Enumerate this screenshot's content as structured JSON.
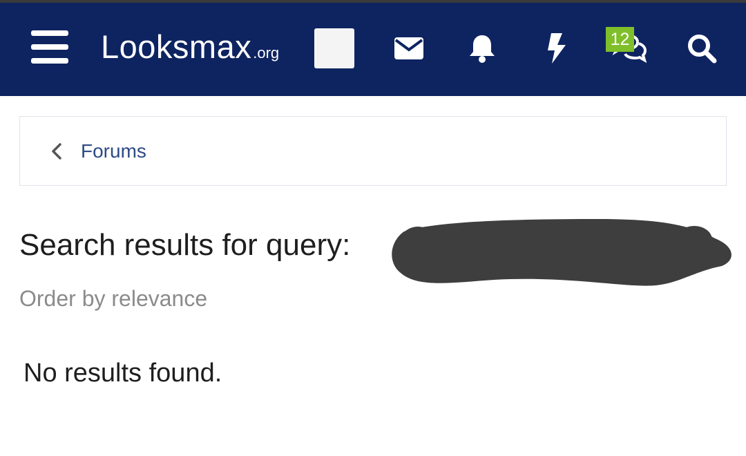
{
  "header": {
    "logo_main": "Looksmax",
    "logo_tld": ".org",
    "icons": [
      "menu-icon",
      "avatar",
      "envelope-icon",
      "bell-icon",
      "bolt-icon",
      "chat-icon",
      "search-icon"
    ],
    "chat_badge": "12",
    "colors": {
      "navbar": "#0e2461",
      "badge": "#7fbf2a"
    }
  },
  "breadcrumb": {
    "label": "Forums"
  },
  "main": {
    "title": "Search results for query:",
    "order_label": "Order by relevance",
    "empty_message": "No results found."
  }
}
